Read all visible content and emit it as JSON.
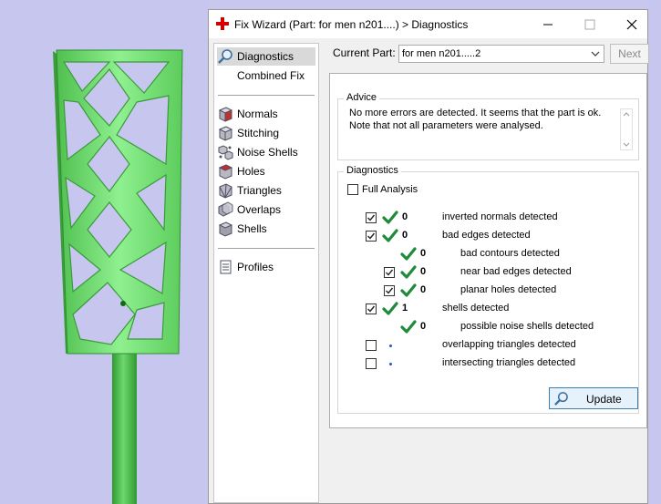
{
  "window": {
    "title": "Fix Wizard (Part: for men n201....) > Diagnostics",
    "minimize_icon": "minimize-icon",
    "maximize_icon": "maximize-icon",
    "close_icon": "close-icon"
  },
  "nav": {
    "primary": [
      {
        "label": "Diagnostics",
        "icon": "magnifier-icon",
        "selected": true
      },
      {
        "label": "Combined Fix",
        "icon": "",
        "selected": false
      }
    ],
    "tools": [
      {
        "label": "Normals",
        "icon": "normals-icon"
      },
      {
        "label": "Stitching",
        "icon": "stitching-icon"
      },
      {
        "label": "Noise Shells",
        "icon": "noise-shells-icon"
      },
      {
        "label": "Holes",
        "icon": "holes-icon"
      },
      {
        "label": "Triangles",
        "icon": "triangles-icon"
      },
      {
        "label": "Overlaps",
        "icon": "overlaps-icon"
      },
      {
        "label": "Shells",
        "icon": "shells-icon"
      }
    ],
    "extra": [
      {
        "label": "Profiles",
        "icon": "profiles-icon"
      }
    ]
  },
  "current_part": {
    "label": "Current Part:",
    "value": "for men n201.....2",
    "next_label": "Next"
  },
  "advice": {
    "title": "Advice",
    "line1": "No more errors are detected. It seems that the part is ok.",
    "line2": "Note that not all parameters were analysed."
  },
  "diagnostics": {
    "title": "Diagnostics",
    "full_analysis_label": "Full Analysis",
    "full_analysis_checked": false,
    "rows": [
      {
        "checkbox": true,
        "checked": true,
        "status": "ok",
        "count": "0",
        "label": "inverted normals detected",
        "indent": 0
      },
      {
        "checkbox": true,
        "checked": true,
        "status": "ok",
        "count": "0",
        "label": "bad edges detected",
        "indent": 0
      },
      {
        "checkbox": false,
        "checked": false,
        "status": "ok",
        "count": "0",
        "label": "bad contours detected",
        "indent": 1
      },
      {
        "checkbox": true,
        "checked": true,
        "status": "ok",
        "count": "0",
        "label": "near bad edges detected",
        "indent": 1
      },
      {
        "checkbox": true,
        "checked": true,
        "status": "ok",
        "count": "0",
        "label": "planar holes detected",
        "indent": 1
      },
      {
        "checkbox": true,
        "checked": true,
        "status": "ok",
        "count": "1",
        "label": "shells detected",
        "indent": 0
      },
      {
        "checkbox": false,
        "checked": false,
        "status": "ok",
        "count": "0",
        "label": "possible noise shells detected",
        "indent": 1
      },
      {
        "checkbox": true,
        "checked": false,
        "status": "dot",
        "count": "",
        "label": "overlapping triangles detected",
        "indent": 0
      },
      {
        "checkbox": true,
        "checked": false,
        "status": "dot",
        "count": "",
        "label": "intersecting triangles detected",
        "indent": 0
      }
    ],
    "update_label": "Update"
  },
  "colors": {
    "model_green": "#6fd66f",
    "check_green": "#1f8a3a",
    "viewport_bg": "#c6c6ee",
    "dot_blue": "#2a50c8",
    "brand_red": "#d40000"
  }
}
